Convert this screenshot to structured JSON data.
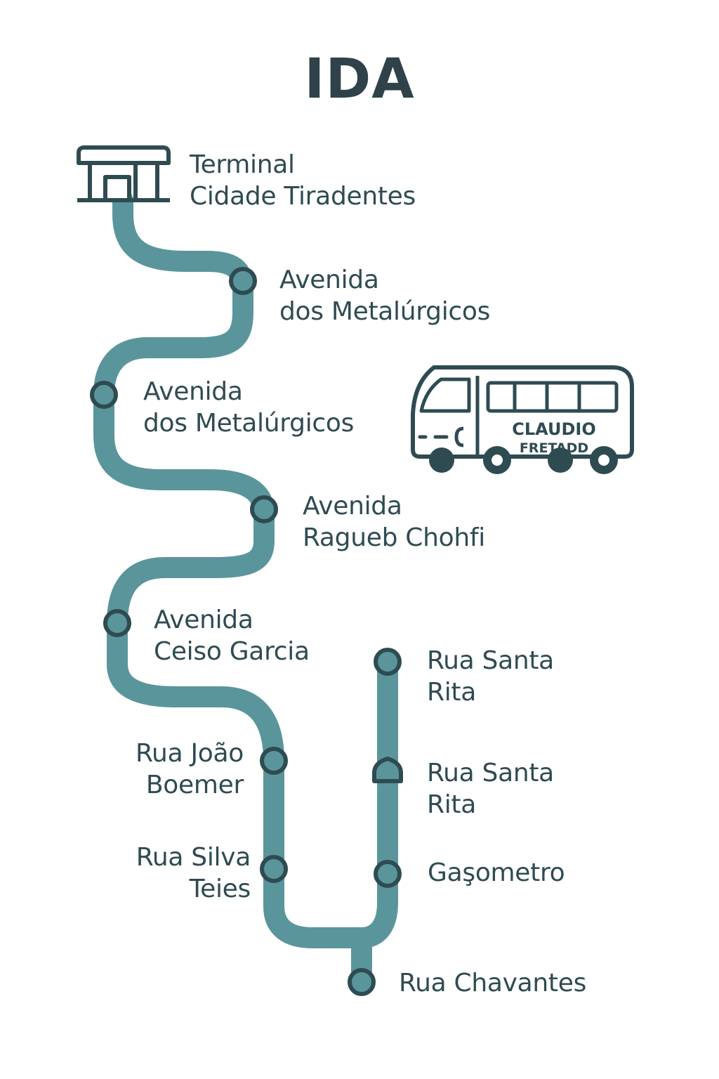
{
  "title": "IDA",
  "bus": {
    "line1": "CLAUDIO",
    "line2": "FRETADD"
  },
  "stops": [
    {
      "id": "terminal",
      "line1": "Terminal",
      "line2": "Cidade Tiradentes",
      "marker": "terminal-building"
    },
    {
      "id": "metalurgicos-1",
      "line1": "Avenida",
      "line2": "dos Metalúrgicos",
      "marker": "circle"
    },
    {
      "id": "metalurgicos-2",
      "line1": "Avenida",
      "line2": "dos Metalúrgicos",
      "marker": "circle"
    },
    {
      "id": "ragueb-chohfi",
      "line1": "Avenida",
      "line2": "Ragueb Chohfi",
      "marker": "circle"
    },
    {
      "id": "celso-garcia",
      "line1": "Avenida",
      "line2": "Ceiso Garcia",
      "marker": "circle"
    },
    {
      "id": "joao-boemer",
      "line1": "Rua João",
      "line2": "Boemer",
      "marker": "circle"
    },
    {
      "id": "silva-teles",
      "line1": "Rua Silva",
      "line2": "Teies",
      "marker": "circle"
    },
    {
      "id": "chavantes",
      "line1": "Rua Chavantes",
      "line2": "",
      "marker": "circle"
    },
    {
      "id": "gasometro",
      "line1": "Gaşometro",
      "line2": "",
      "marker": "circle"
    },
    {
      "id": "santa-rita-2",
      "line1": "Rua Santa",
      "line2": "Rita",
      "marker": "dome"
    },
    {
      "id": "santa-rita-1",
      "line1": "Rua Santa",
      "line2": "Rita",
      "marker": "circle"
    }
  ],
  "colors": {
    "route": "#5a959c",
    "outline": "#2f4b52",
    "text": "#2f4b52",
    "title": "#2f4249"
  }
}
